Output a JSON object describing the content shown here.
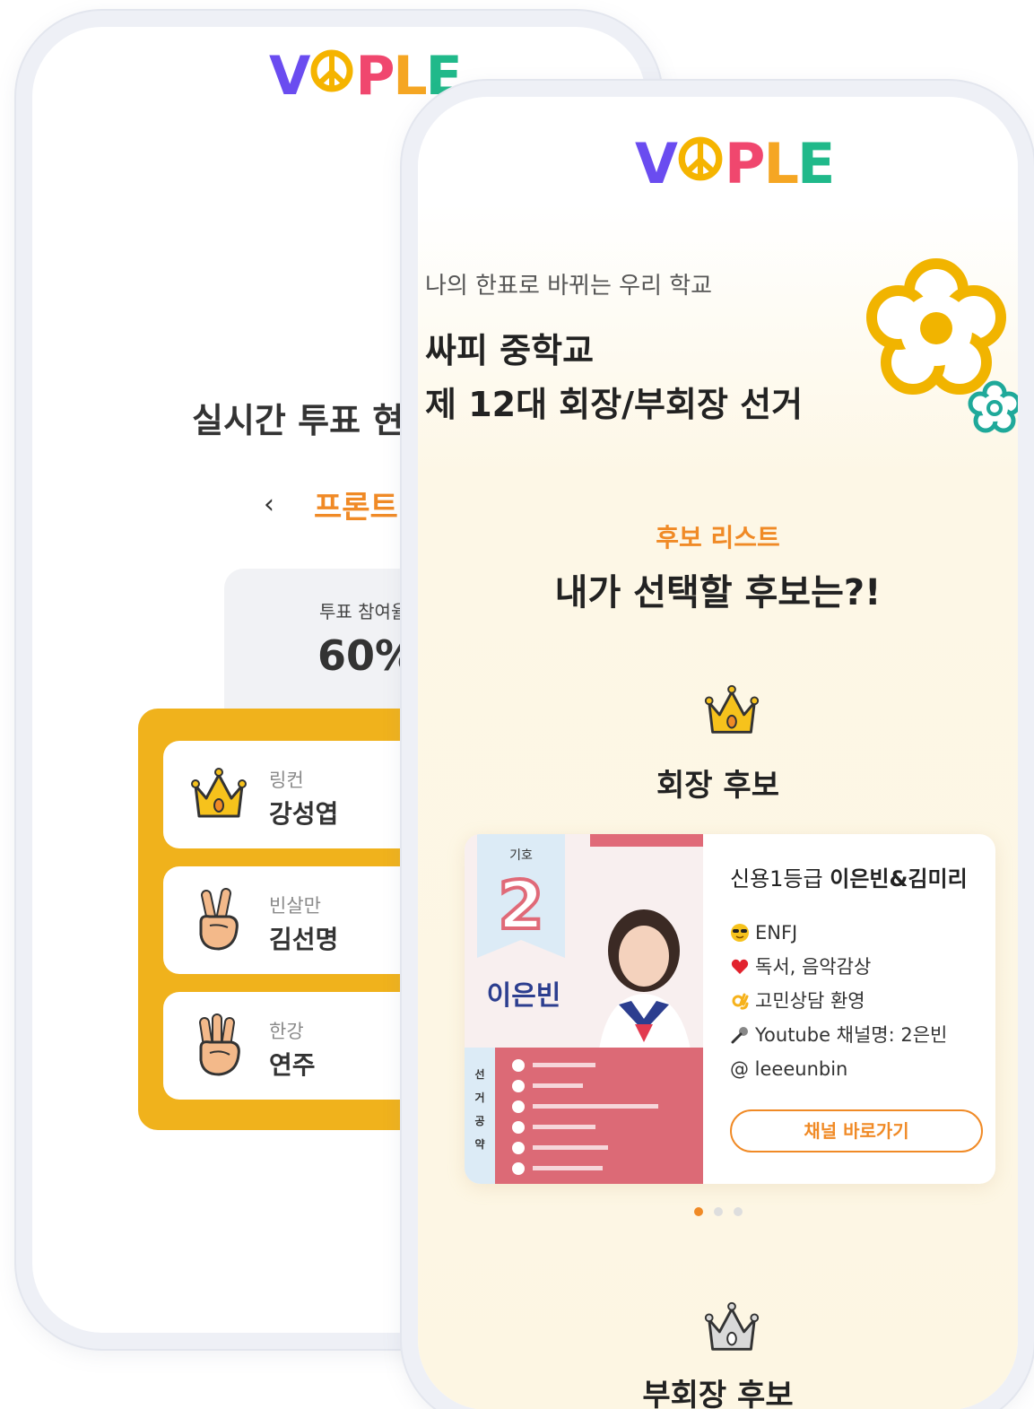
{
  "logo": {
    "letters": [
      "V",
      "P",
      "L",
      "E"
    ]
  },
  "back_screen": {
    "title": "실시간 투표 현",
    "nav_back_symbol": "‹",
    "election_tab": "프론트",
    "participation_label": "투표 참여율",
    "participation_value": "60%",
    "candidates": [
      {
        "party": "링컨",
        "name": "강성엽",
        "icon": "crown-icon"
      },
      {
        "party": "빈살만",
        "name": "김선명",
        "icon": "peace-hand-icon"
      },
      {
        "party": "한강",
        "name": "연주",
        "icon": "three-finger-hand-icon"
      }
    ]
  },
  "front_screen": {
    "subtitle": "나의 한표로 바뀌는 우리 학교",
    "school": "싸피 중학교",
    "election": "제 12대 회장/부회장 선거",
    "section_label": "후보 리스트",
    "section_heading": "내가 선택할 후보는?!",
    "president_group": "회장 후보",
    "vice_group": "부회장 후보",
    "candidate": {
      "title_prefix": "신용1등급",
      "title_names": "이은빈&김미리",
      "lines": [
        {
          "icon": "sunglasses-emoji-icon",
          "text": "ENFJ"
        },
        {
          "icon": "heart-emoji-icon",
          "text": "독서, 음악감상"
        },
        {
          "icon": "ok-hand-emoji-icon",
          "text": "고민상담 환영"
        },
        {
          "icon": "microphone-emoji-icon",
          "text": "Youtube 채널명: 2은빈"
        },
        {
          "icon": "",
          "text": "@ leeeunbin"
        }
      ],
      "button": "채널 바로가기",
      "poster": {
        "number_label": "기호",
        "number": "2",
        "name": "이은빈",
        "pledge_side_label": [
          "선",
          "거",
          "공",
          "약"
        ]
      }
    },
    "carousel": {
      "total": 3,
      "active": 1
    }
  },
  "colors": {
    "accent_orange": "#f08a26",
    "panel_yellow": "#f0b21c",
    "logo_v": "#6a4cf0",
    "logo_p": "#f0476e",
    "logo_l": "#f5a623",
    "logo_e": "#20b98a",
    "flower_yellow": "#f1b400",
    "flower_teal": "#1fa99a"
  }
}
